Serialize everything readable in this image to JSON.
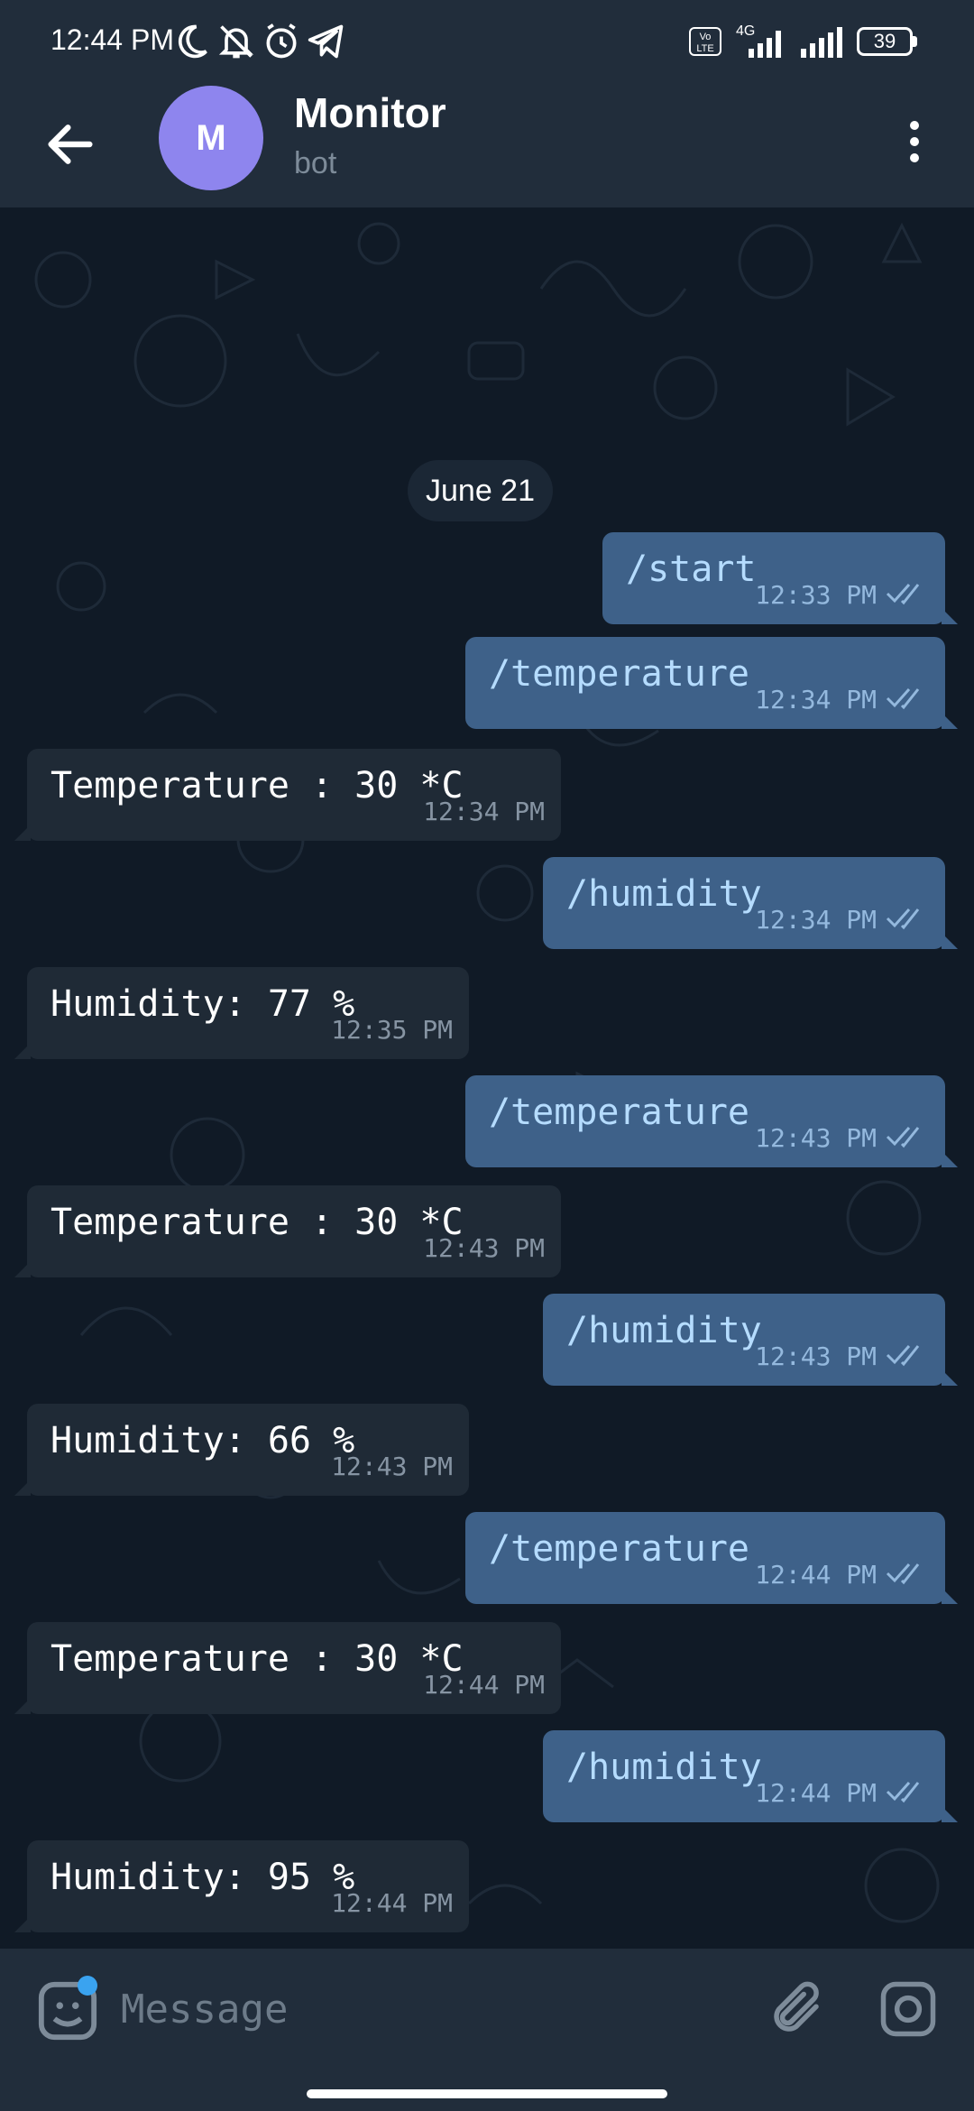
{
  "status_bar": {
    "time": "12:44 PM",
    "network": "4G",
    "battery": "39"
  },
  "header": {
    "avatar_letter": "M",
    "title": "Monitor",
    "subtitle": "bot",
    "back_icon": "arrow-left-icon",
    "menu_icon": "more-vertical-icon"
  },
  "chat": {
    "date": "June 21",
    "messages": [
      {
        "text": "/start",
        "time": "12:33 PM"
      },
      {
        "text": "/temperature",
        "time": "12:34 PM"
      },
      {
        "text": "Temperature : 30 *C",
        "time": "12:34 PM"
      },
      {
        "text": "/humidity",
        "time": "12:34 PM"
      },
      {
        "text": "Humidity: 77 %",
        "time": "12:35 PM"
      },
      {
        "text": "/temperature",
        "time": "12:43 PM"
      },
      {
        "text": "Temperature : 30 *C",
        "time": "12:43 PM"
      },
      {
        "text": "/humidity",
        "time": "12:43 PM"
      },
      {
        "text": "Humidity: 66 %",
        "time": "12:43 PM"
      },
      {
        "text": "/temperature",
        "time": "12:44 PM"
      },
      {
        "text": "Temperature : 30 *C",
        "time": "12:44 PM"
      },
      {
        "text": "/humidity",
        "time": "12:44 PM"
      },
      {
        "text": "Humidity: 95 %",
        "time": "12:44 PM"
      }
    ]
  },
  "input": {
    "placeholder": "Message",
    "value": ""
  },
  "colors": {
    "header_bg": "#212d3b",
    "outgoing_bubble": "#3e6189",
    "incoming_bubble": "#1f2a36",
    "outgoing_text": "#b5dcff",
    "avatar": "#8e85ee",
    "accent": "#3aa3f0"
  }
}
